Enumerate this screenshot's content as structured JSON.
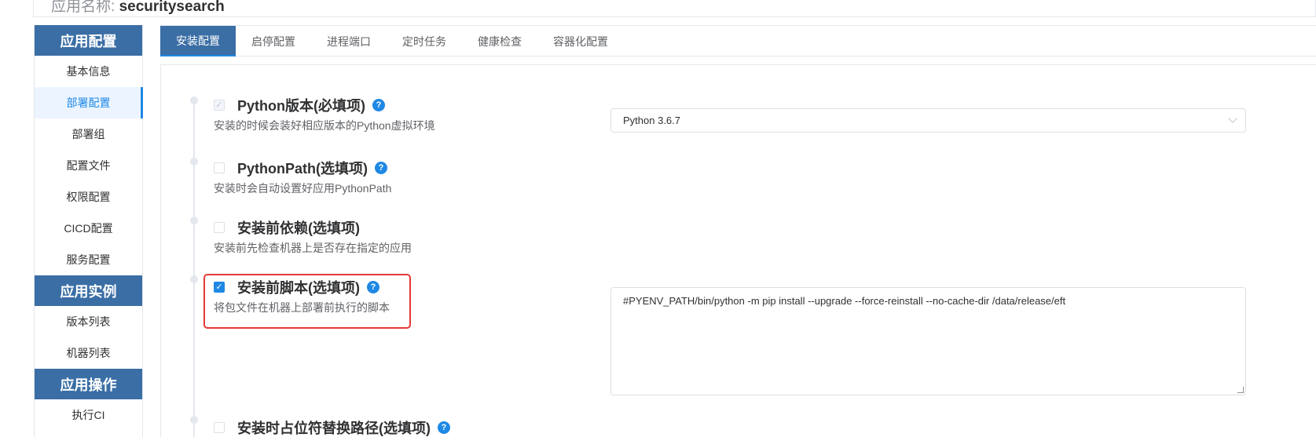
{
  "header": {
    "app_name_label": "应用名称:",
    "app_name": "securitysearch"
  },
  "sidebar": {
    "groups": [
      {
        "title": "应用配置",
        "items": [
          "基本信息",
          "部署配置",
          "部署组",
          "配置文件",
          "权限配置",
          "CICD配置",
          "服务配置"
        ]
      },
      {
        "title": "应用实例",
        "items": [
          "版本列表",
          "机器列表"
        ]
      },
      {
        "title": "应用操作",
        "items": [
          "执行CI"
        ]
      }
    ],
    "active_item": "部署配置"
  },
  "tabs": [
    "安装配置",
    "启停配置",
    "进程端口",
    "定时任务",
    "健康检查",
    "容器化配置"
  ],
  "active_tab": "安装配置",
  "config_items": [
    {
      "title": "Python版本(必填项)",
      "desc": "安装的时候会装好相应版本的Python虚拟环境",
      "checked": true,
      "disabled": true
    },
    {
      "title": "PythonPath(选填项)",
      "desc": "安装时会自动设置好应用PythonPath",
      "checked": false
    },
    {
      "title": "安装前依赖(选填项)",
      "desc": "安装前先检查机器上是否存在指定的应用",
      "checked": false
    },
    {
      "title": "安装前脚本(选填项)",
      "desc": "将包文件在机器上部署前执行的脚本",
      "checked": true
    },
    {
      "title": "安装时占位符替换路径(选填项)",
      "desc": "",
      "checked": false
    }
  ],
  "help_glyph": "?",
  "python_version": {
    "value": "Python 3.6.7"
  },
  "pre_install_script": {
    "value": "#PYENV_PATH/bin/python -m pip install --upgrade --force-reinstall --no-cache-dir /data/release/eft"
  },
  "colors": {
    "primary": "#1e88e5",
    "group_header": "#3a6ea5",
    "highlight": "#e53935"
  }
}
